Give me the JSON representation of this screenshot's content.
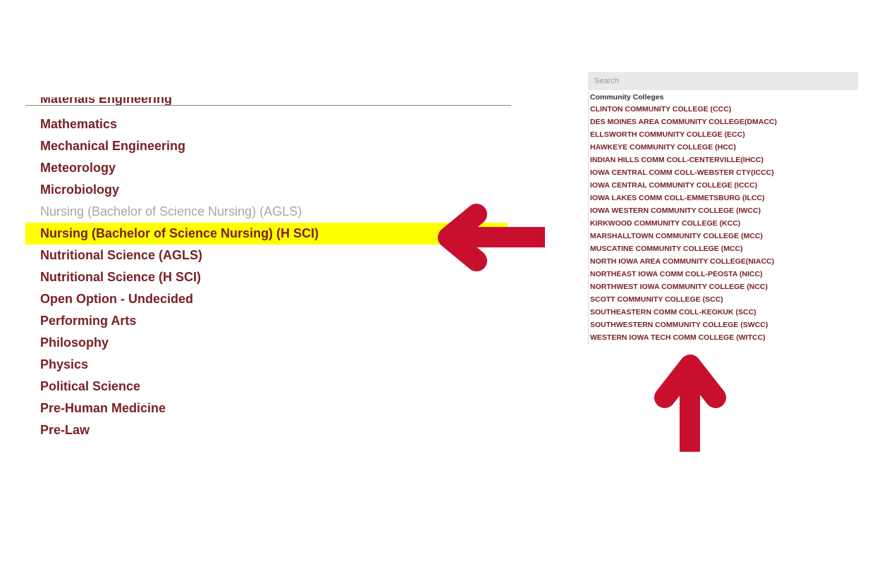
{
  "majors": {
    "items": [
      {
        "label": "Materials Engineering",
        "state": "cut-off"
      },
      {
        "label": "Mathematics",
        "state": "normal"
      },
      {
        "label": "Mechanical Engineering",
        "state": "normal"
      },
      {
        "label": "Meteorology",
        "state": "normal"
      },
      {
        "label": "Microbiology",
        "state": "normal"
      },
      {
        "label": "Nursing (Bachelor of Science Nursing) (AGLS)",
        "state": "disabled"
      },
      {
        "label": "Nursing (Bachelor of Science Nursing) (H SCI)",
        "state": "highlighted"
      },
      {
        "label": "Nutritional Science (AGLS)",
        "state": "normal"
      },
      {
        "label": "Nutritional Science (H SCI)",
        "state": "normal"
      },
      {
        "label": "Open Option - Undecided",
        "state": "normal"
      },
      {
        "label": "Performing Arts",
        "state": "normal"
      },
      {
        "label": "Philosophy",
        "state": "normal"
      },
      {
        "label": "Physics",
        "state": "normal"
      },
      {
        "label": "Political Science",
        "state": "normal"
      },
      {
        "label": "Pre-Human Medicine",
        "state": "normal"
      },
      {
        "label": "Pre-Law",
        "state": "normal"
      }
    ]
  },
  "colleges": {
    "search_placeholder": "Search",
    "group_label": "Community Colleges",
    "items": [
      "CLINTON COMMUNITY COLLEGE (CCC)",
      "DES MOINES AREA COMMUNITY COLLEGE(DMACC)",
      "ELLSWORTH COMMUNITY COLLEGE (ECC)",
      "HAWKEYE COMMUNITY COLLEGE (HCC)",
      "INDIAN HILLS COMM COLL-CENTERVILLE(IHCC)",
      "IOWA CENTRAL COMM COLL-WEBSTER CTY(ICCC)",
      "IOWA CENTRAL COMMUNITY COLLEGE (ICCC)",
      "IOWA LAKES COMM COLL-EMMETSBURG (ILCC)",
      "IOWA WESTERN COMMUNITY COLLEGE (IWCC)",
      "KIRKWOOD COMMUNITY COLLEGE (KCC)",
      "MARSHALLTOWN COMMUNITY COLLEGE (MCC)",
      "MUSCATINE COMMUNITY COLLEGE (MCC)",
      "NORTH IOWA AREA COMMUNITY COLLEGE(NIACC)",
      "NORTHEAST IOWA COMM COLL-PEOSTA (NICC)",
      "NORTHWEST IOWA COMMUNITY COLLEGE (NCC)",
      "SCOTT COMMUNITY COLLEGE (SCC)",
      "SOUTHEASTERN COMM COLL-KEOKUK (SCC)",
      "SOUTHWESTERN COMMUNITY COLLEGE (SWCC)",
      "WESTERN IOWA TECH COMM COLLEGE (WITCC)"
    ]
  },
  "annotations": {
    "left_arrow_icon": "arrow-left-icon",
    "up_arrow_icon": "arrow-up-icon",
    "arrow_color": "#c8102e",
    "highlight_color": "#ffff00",
    "text_color": "#7a2025"
  }
}
